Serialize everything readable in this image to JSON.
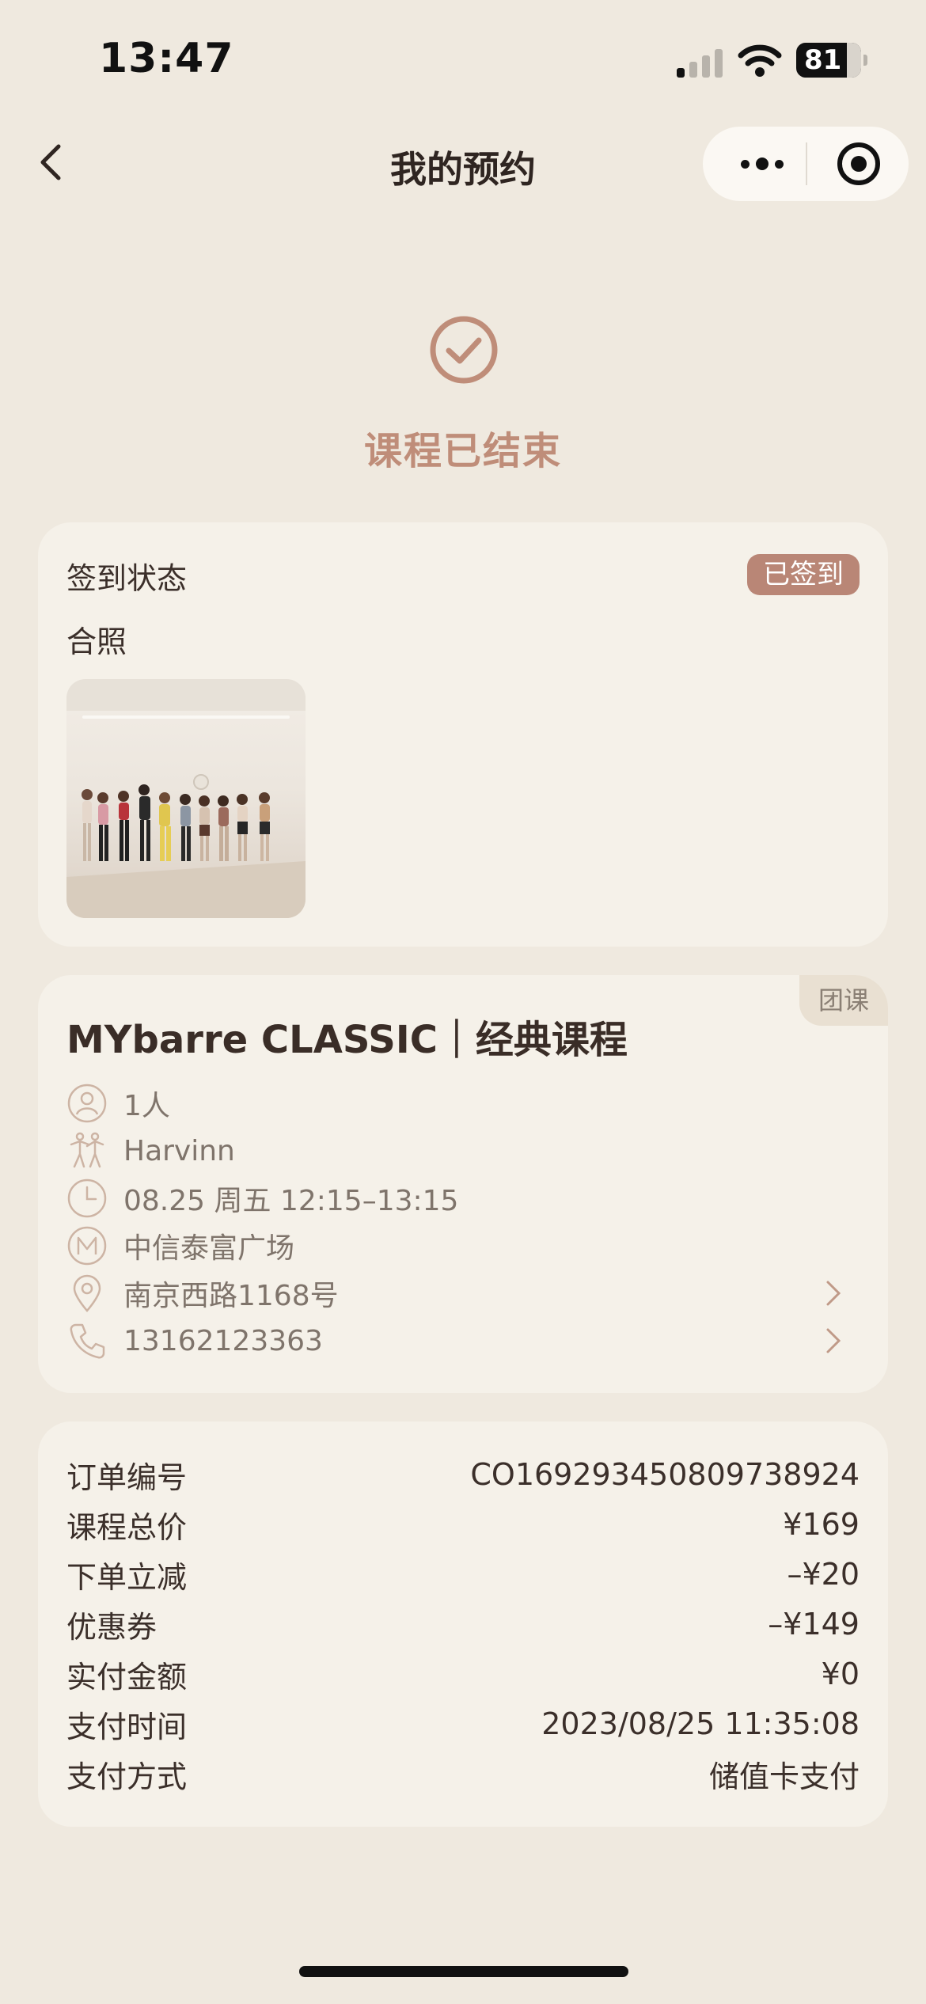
{
  "status_bar": {
    "time": "13:47",
    "battery": "81"
  },
  "nav": {
    "title": "我的预约"
  },
  "hero": {
    "status": "课程已结束"
  },
  "checkin": {
    "label": "签到状态",
    "badge": "已签到",
    "photo_label": "合照"
  },
  "course": {
    "tag": "团课",
    "title": "MYbarre CLASSIC｜经典课程",
    "people": "1人",
    "coach": "Harvinn",
    "time": "08.25 周五 12:15–13:15",
    "venue": "中信泰富广场",
    "address": "南京西路1168号",
    "phone": "13162123363"
  },
  "order": {
    "rows": [
      {
        "k": "订单编号",
        "v": "CO1692934508097389​24"
      },
      {
        "k": "课程总价",
        "v": "¥169"
      },
      {
        "k": "下单立减",
        "v": "–¥20"
      },
      {
        "k": "优惠券",
        "v": "–¥149"
      },
      {
        "k": "实付金额",
        "v": "¥0"
      },
      {
        "k": "支付时间",
        "v": "2023/08/25 11:35:08"
      },
      {
        "k": "支付方式",
        "v": "储值卡支付"
      }
    ]
  },
  "colors": {
    "background": "#efe9df",
    "card": "#f5f1e9",
    "accent": "#bf8d79",
    "badge": "#b98676"
  }
}
